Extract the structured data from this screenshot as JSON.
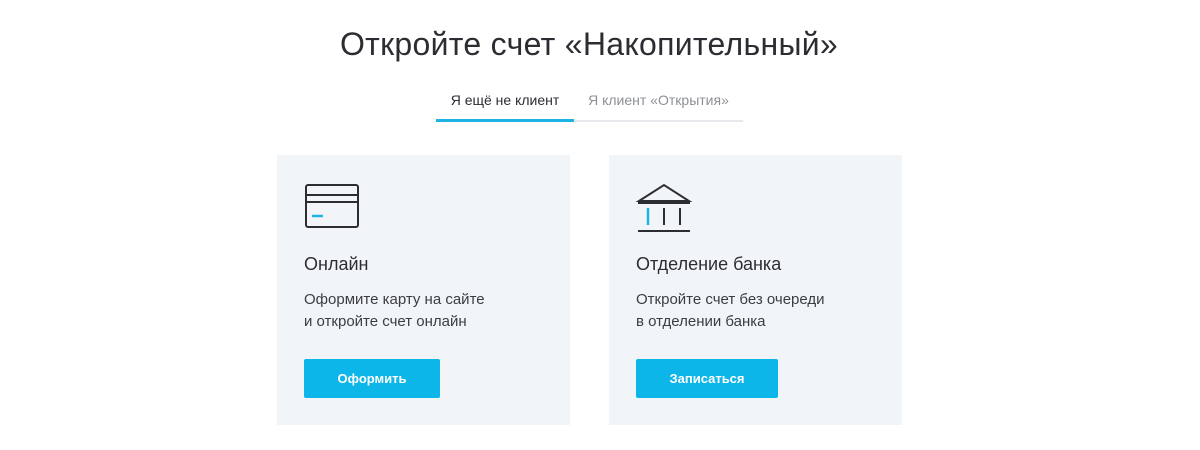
{
  "page": {
    "title": "Откройте счет «Накопительный»"
  },
  "tabs": [
    {
      "label": "Я ещё не клиент",
      "active": true
    },
    {
      "label": "Я клиент «Открытия»",
      "active": false
    }
  ],
  "cards": [
    {
      "icon": "credit-card-icon",
      "title": "Онлайн",
      "description": "Оформите карту на сайте\nи откройте счет онлайн",
      "button_label": "Оформить"
    },
    {
      "icon": "bank-building-icon",
      "title": "Отделение банка",
      "description": "Откройте счет без очереди\nв отделении банка",
      "button_label": "Записаться"
    }
  ],
  "colors": {
    "accent": "#0db6e8",
    "card_background": "#f2f5f8",
    "text_primary": "#2b2d33",
    "text_muted": "#8d9098",
    "tab_underline": "#1db4e3",
    "icon_stroke": "#2b2d33"
  }
}
